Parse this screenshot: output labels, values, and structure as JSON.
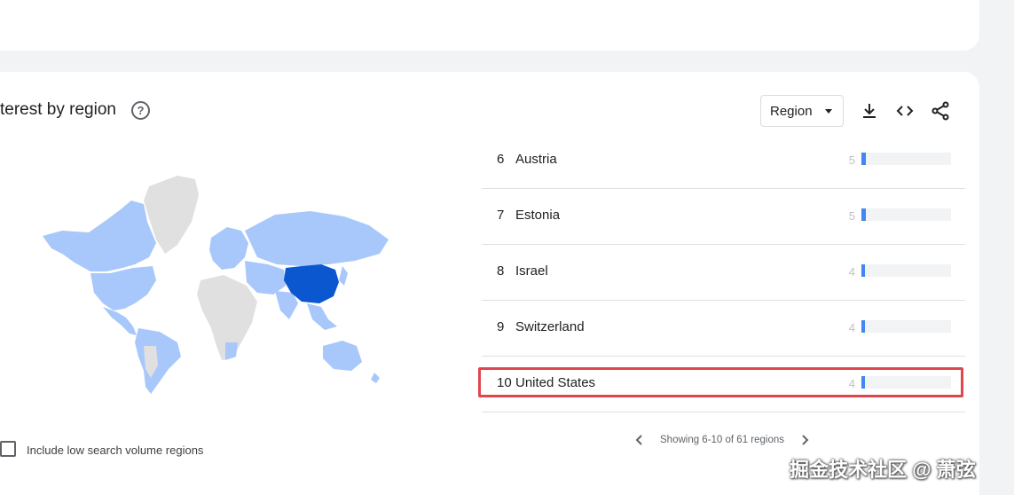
{
  "section": {
    "title": "terest by region"
  },
  "controls": {
    "region_select_value": "Region"
  },
  "rows": [
    {
      "rank": "6",
      "name": "Austria",
      "value": "5",
      "fill": 5
    },
    {
      "rank": "7",
      "name": "Estonia",
      "value": "5",
      "fill": 5
    },
    {
      "rank": "8",
      "name": "Israel",
      "value": "4",
      "fill": 4
    },
    {
      "rank": "9",
      "name": "Switzerland",
      "value": "4",
      "fill": 4
    },
    {
      "rank": "10",
      "name": "United States",
      "value": "4",
      "fill": 4
    }
  ],
  "pager": {
    "info": "Showing 6-10 of 61 regions"
  },
  "options": {
    "include_low_volume_label": "Include low search volume regions"
  },
  "watermark": "掘金技术社区 @ 萧弦",
  "colors": {
    "map_highlight": "#0b57d0",
    "map_mid": "#a8c7fa",
    "map_none": "#e0e0e0",
    "bar": "#4285f4",
    "annotation_box": "#e0464d"
  },
  "icons": [
    "help-icon",
    "download-icon",
    "embed-code-icon",
    "share-icon",
    "chevron-left-icon",
    "chevron-right-icon"
  ]
}
